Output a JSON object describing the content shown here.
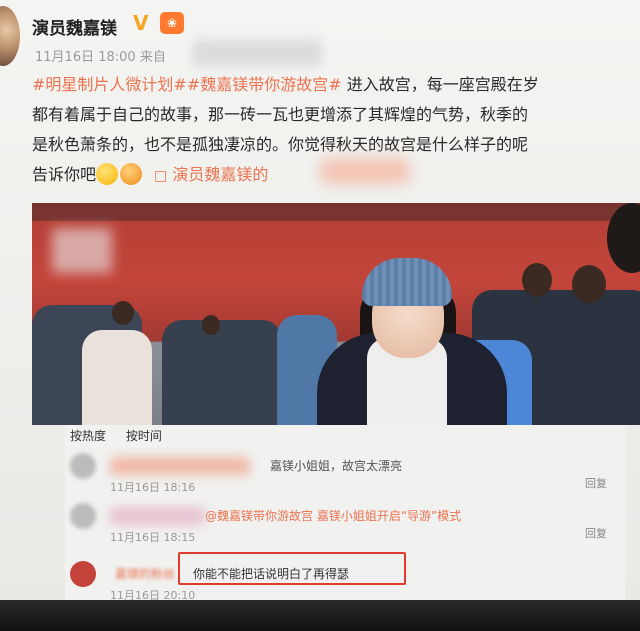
{
  "post": {
    "author": "演员魏嘉镁",
    "vip_badge": "V",
    "level_badge": "❀",
    "meta": "11月16日 18:00 来自",
    "tag1": "#明星制片人微计划#",
    "tag2": "#魏嘉镁带你游故宫#",
    "line1_rest": " 进入故宫，每一座宫殿在岁",
    "line2": "都有着属于自己的故事，那一砖一瓦也更增添了其辉煌的气势，秋季的",
    "line3": "是秋色萧条的，也不是孤独凄凉的。你觉得秋天的故宫是什么样子的呢",
    "line4": "告诉你吧",
    "link_icon": "□",
    "link_text": "演员魏嘉镁的"
  },
  "comments": {
    "tabs": [
      "按热度",
      "按时间"
    ],
    "items": [
      {
        "text": "嘉镁小姐姐，故宫太漂亮",
        "time": "11月16日 18:16",
        "reply": "回复"
      },
      {
        "text": "@魏嘉镁带你游故宫  嘉镁小姐姐开启“导游”模式",
        "time": "11月16日 18:15",
        "reply": "回复"
      },
      {
        "name": "嘉镁的粉丝",
        "text": "你能不能把话说明白了再得瑟",
        "time": "11月16日 20:10"
      }
    ]
  },
  "colors": {
    "tag": "#eb7350",
    "highlight": "#e03b2f"
  }
}
